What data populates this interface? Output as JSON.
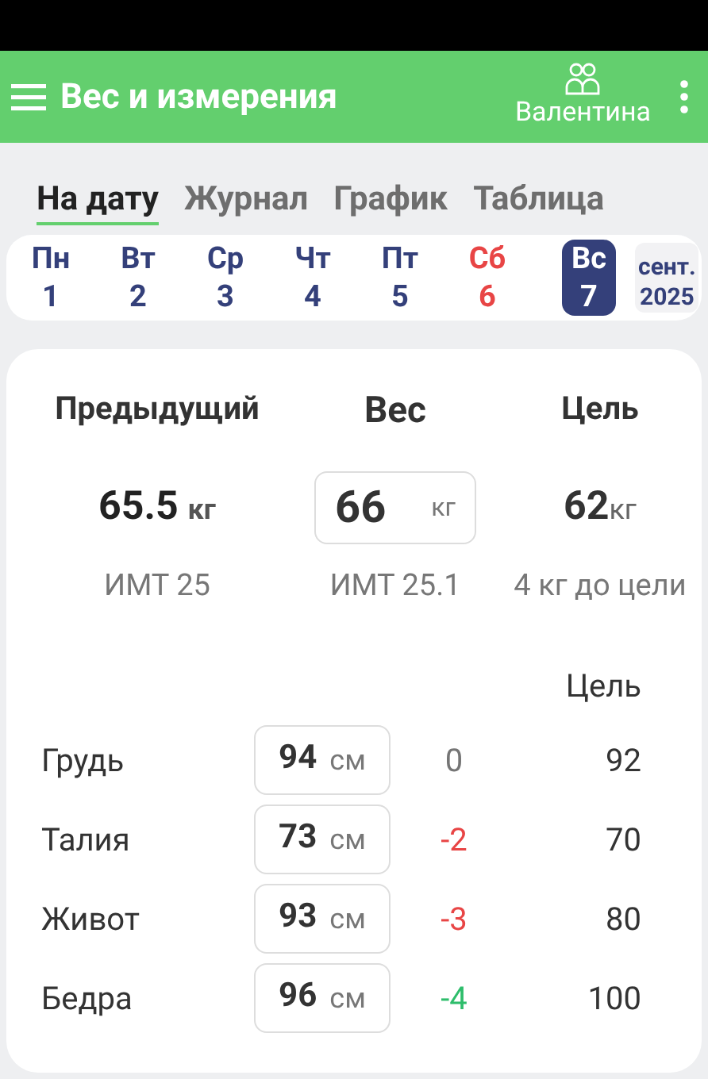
{
  "app_bar": {
    "title": "Вес и измерения",
    "profile": "Валентина"
  },
  "tabs": [
    {
      "label": "На дату",
      "selected": true
    },
    {
      "label": "Журнал",
      "selected": false
    },
    {
      "label": "График",
      "selected": false
    },
    {
      "label": "Таблица",
      "selected": false
    }
  ],
  "week": [
    {
      "day": "Пн",
      "date": "1",
      "color": "#34407a",
      "selected": false
    },
    {
      "day": "Вт",
      "date": "2",
      "color": "#34407a",
      "selected": false
    },
    {
      "day": "Ср",
      "date": "3",
      "color": "#34407a",
      "selected": false
    },
    {
      "day": "Чт",
      "date": "4",
      "color": "#34407a",
      "selected": false
    },
    {
      "day": "Пт",
      "date": "5",
      "color": "#34407a",
      "selected": false
    },
    {
      "day": "Сб",
      "date": "6",
      "color": "#e84545",
      "selected": false
    },
    {
      "day": "Вс",
      "date": "7",
      "color": "#34407a",
      "selected": true
    }
  ],
  "month": {
    "month": "сент.",
    "year": "2025"
  },
  "weight": {
    "headers": [
      "Предыдущий",
      "Вес",
      "Цель"
    ],
    "previous": {
      "value": "65.5",
      "unit": "кг"
    },
    "current": {
      "value": "66",
      "unit": "кг"
    },
    "goal": {
      "value": "62",
      "unit": "кг"
    },
    "bmi_previous": "ИМТ 25",
    "bmi_current": "ИМТ 25.1",
    "to_goal": "4 кг до цели"
  },
  "measurements": {
    "goal_header": "Цель",
    "rows": [
      {
        "name": "Грудь",
        "value": "94",
        "unit": "см",
        "diff": "0",
        "color": "#757575",
        "goal": "92"
      },
      {
        "name": "Талия",
        "value": "73",
        "unit": "см",
        "diff": "-2",
        "color": "#e84545",
        "goal": "70"
      },
      {
        "name": "Живот",
        "value": "93",
        "unit": "см",
        "diff": "-3",
        "color": "#e84545",
        "goal": "80"
      },
      {
        "name": "Бедра",
        "value": "96",
        "unit": "см",
        "diff": "-4",
        "color": "#2ebd6b",
        "goal": "100"
      }
    ]
  }
}
